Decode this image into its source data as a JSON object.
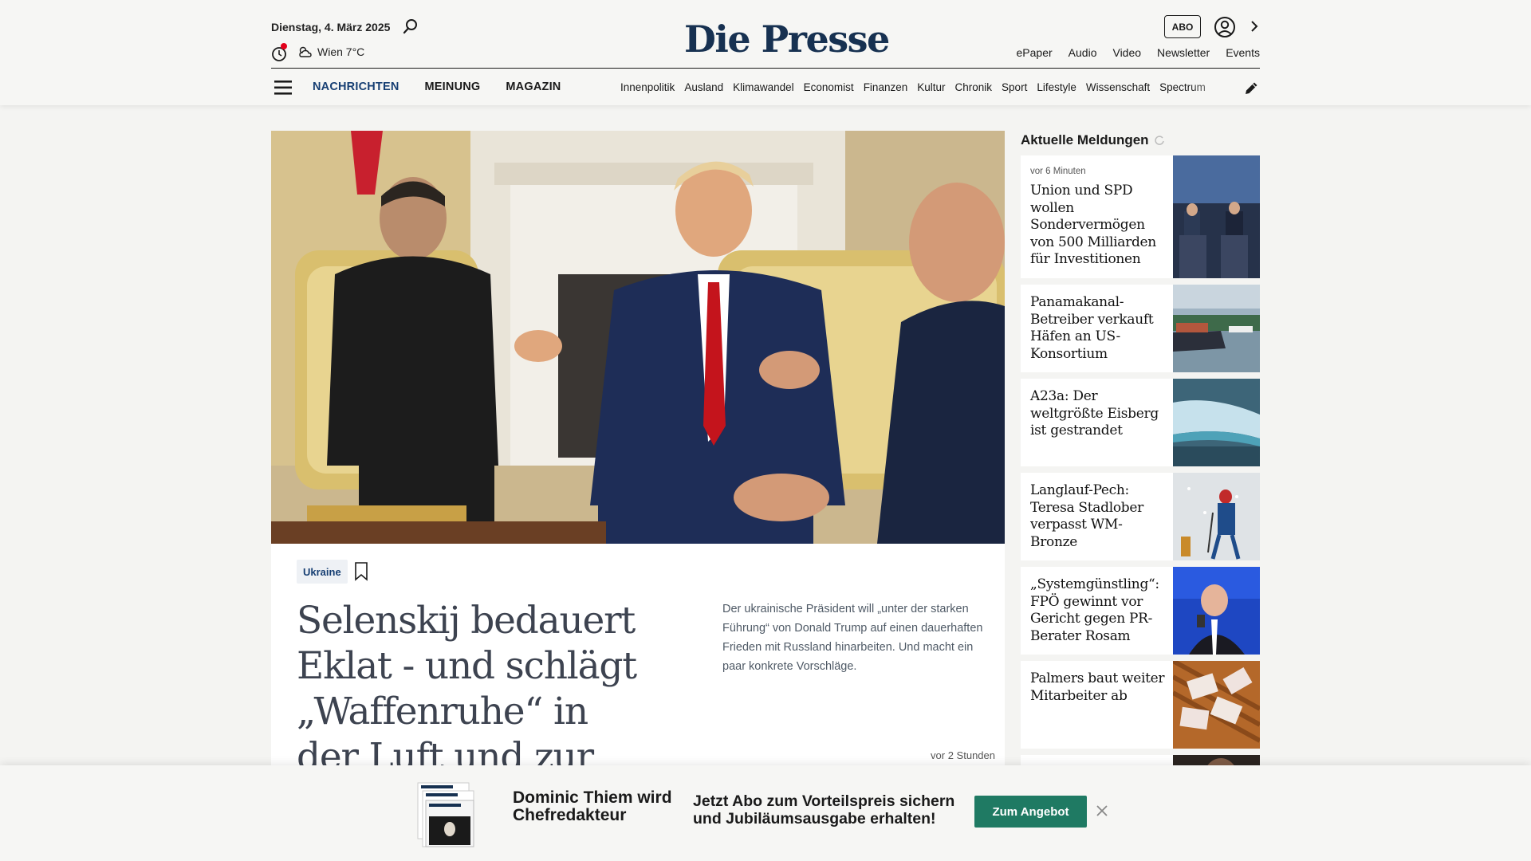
{
  "header": {
    "date": "Dienstag, 4. März 2025",
    "weather": "Wien 7°C",
    "logo": "Die Presse",
    "abo_label": "ABO",
    "top_links": [
      "ePaper",
      "Audio",
      "Video",
      "Newsletter",
      "Events"
    ],
    "main_nav": [
      "NACHRICHTEN",
      "MEINUNG",
      "MAGAZIN"
    ],
    "sub_nav": [
      "Innenpolitik",
      "Ausland",
      "Klimawandel",
      "Economist",
      "Finanzen",
      "Kultur",
      "Chronik",
      "Sport",
      "Lifestyle",
      "Wissenschaft",
      "Spectrum"
    ]
  },
  "article": {
    "tag": "Ukraine",
    "headline": "Selenskij bedauert Eklat - und schlägt „Waffenruhe“ in der Luft und zur See vor",
    "teaser": "Der ukrainische Präsident will „unter der starken Führung“ von Donald Trump auf einen dauerhaften Frieden mit Russland hinarbeiten. Und macht ein paar konkrete Vorschläge.",
    "age": "vor 2 Stunden"
  },
  "sidebar": {
    "title": "Aktuelle Meldungen",
    "items": [
      {
        "time": "vor 6 Minuten",
        "title": "Union und SPD wollen Sondervermögen von 500 Milliarden für Investitionen"
      },
      {
        "time": "",
        "title": "Panamakanal-Betreiber verkauft Häfen an US-Konsortium"
      },
      {
        "time": "",
        "title": "A23a: Der weltgrößte Eisberg ist gestrandet"
      },
      {
        "time": "",
        "title": "Langlauf-Pech: Teresa Stadlober verpasst WM-Bronze"
      },
      {
        "time": "",
        "title": "„Systemgünstling“: FPÖ gewinnt vor Gericht gegen PR-Berater Rosam"
      },
      {
        "time": "",
        "title": "Palmers baut weiter Mitarbeiter ab"
      }
    ]
  },
  "promo": {
    "name": "Dominic Thiem wird Chefredakteur",
    "text": "Jetzt Abo zum Vorteilspreis sichern und Jubiläumsausgabe erhalten!",
    "button": "Zum Angebot"
  },
  "colors": {
    "brand_navy": "#173151",
    "nav_active": "#173f73",
    "cta_green": "#1f7a63",
    "alert_red": "#e3001b"
  }
}
